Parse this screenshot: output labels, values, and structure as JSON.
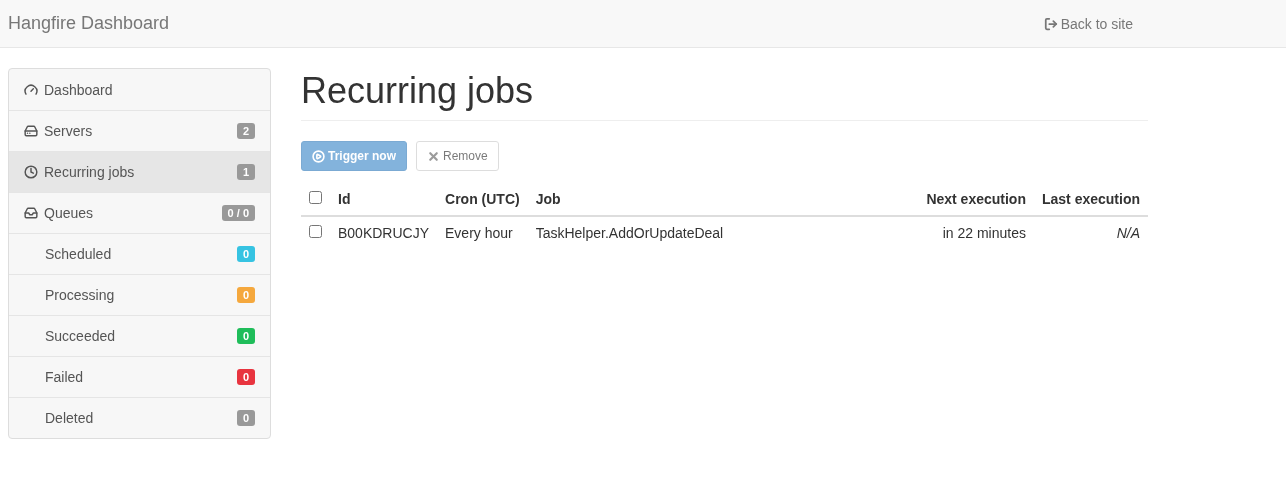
{
  "navbar": {
    "brand": "Hangfire Dashboard",
    "back_link": "Back to site"
  },
  "sidebar": {
    "items": [
      {
        "label": "Dashboard",
        "kind": "main",
        "selected": false
      },
      {
        "label": "Servers",
        "kind": "main",
        "selected": false,
        "badge": "2",
        "color": "#999999"
      },
      {
        "label": "Recurring jobs",
        "kind": "main",
        "selected": true,
        "badge": "1",
        "color": "#999999"
      },
      {
        "label": "Queues",
        "kind": "main",
        "selected": false,
        "badge": "0 / 0",
        "color": "#999999"
      },
      {
        "label": "Scheduled",
        "kind": "sub",
        "selected": false,
        "badge": "0",
        "color": "#36c3e2"
      },
      {
        "label": "Processing",
        "kind": "sub",
        "selected": false,
        "badge": "0",
        "color": "#f5a83d"
      },
      {
        "label": "Succeeded",
        "kind": "sub",
        "selected": false,
        "badge": "0",
        "color": "#1fbd5a"
      },
      {
        "label": "Failed",
        "kind": "sub",
        "selected": false,
        "badge": "0",
        "color": "#e8343f"
      },
      {
        "label": "Deleted",
        "kind": "sub",
        "selected": false,
        "badge": "0",
        "color": "#999999"
      }
    ]
  },
  "page": {
    "title": "Recurring jobs",
    "buttons": [
      {
        "label": "Trigger now",
        "kind": "primary",
        "disabled": true
      },
      {
        "label": "Remove",
        "kind": "default",
        "disabled": true
      }
    ],
    "table": {
      "select_all": {
        "checked": false
      },
      "columns": [
        {
          "label": "Id"
        },
        {
          "label": "Cron (UTC)"
        },
        {
          "label": "Job"
        },
        {
          "label": "Next execution"
        },
        {
          "label": "Last execution"
        }
      ],
      "rows": [
        {
          "checked": false,
          "cells": [
            "B00KDRUCJY",
            "Every hour",
            "TaskHelper.AddOrUpdateDeal",
            "in 22 minutes",
            "N/A"
          ]
        }
      ]
    }
  }
}
